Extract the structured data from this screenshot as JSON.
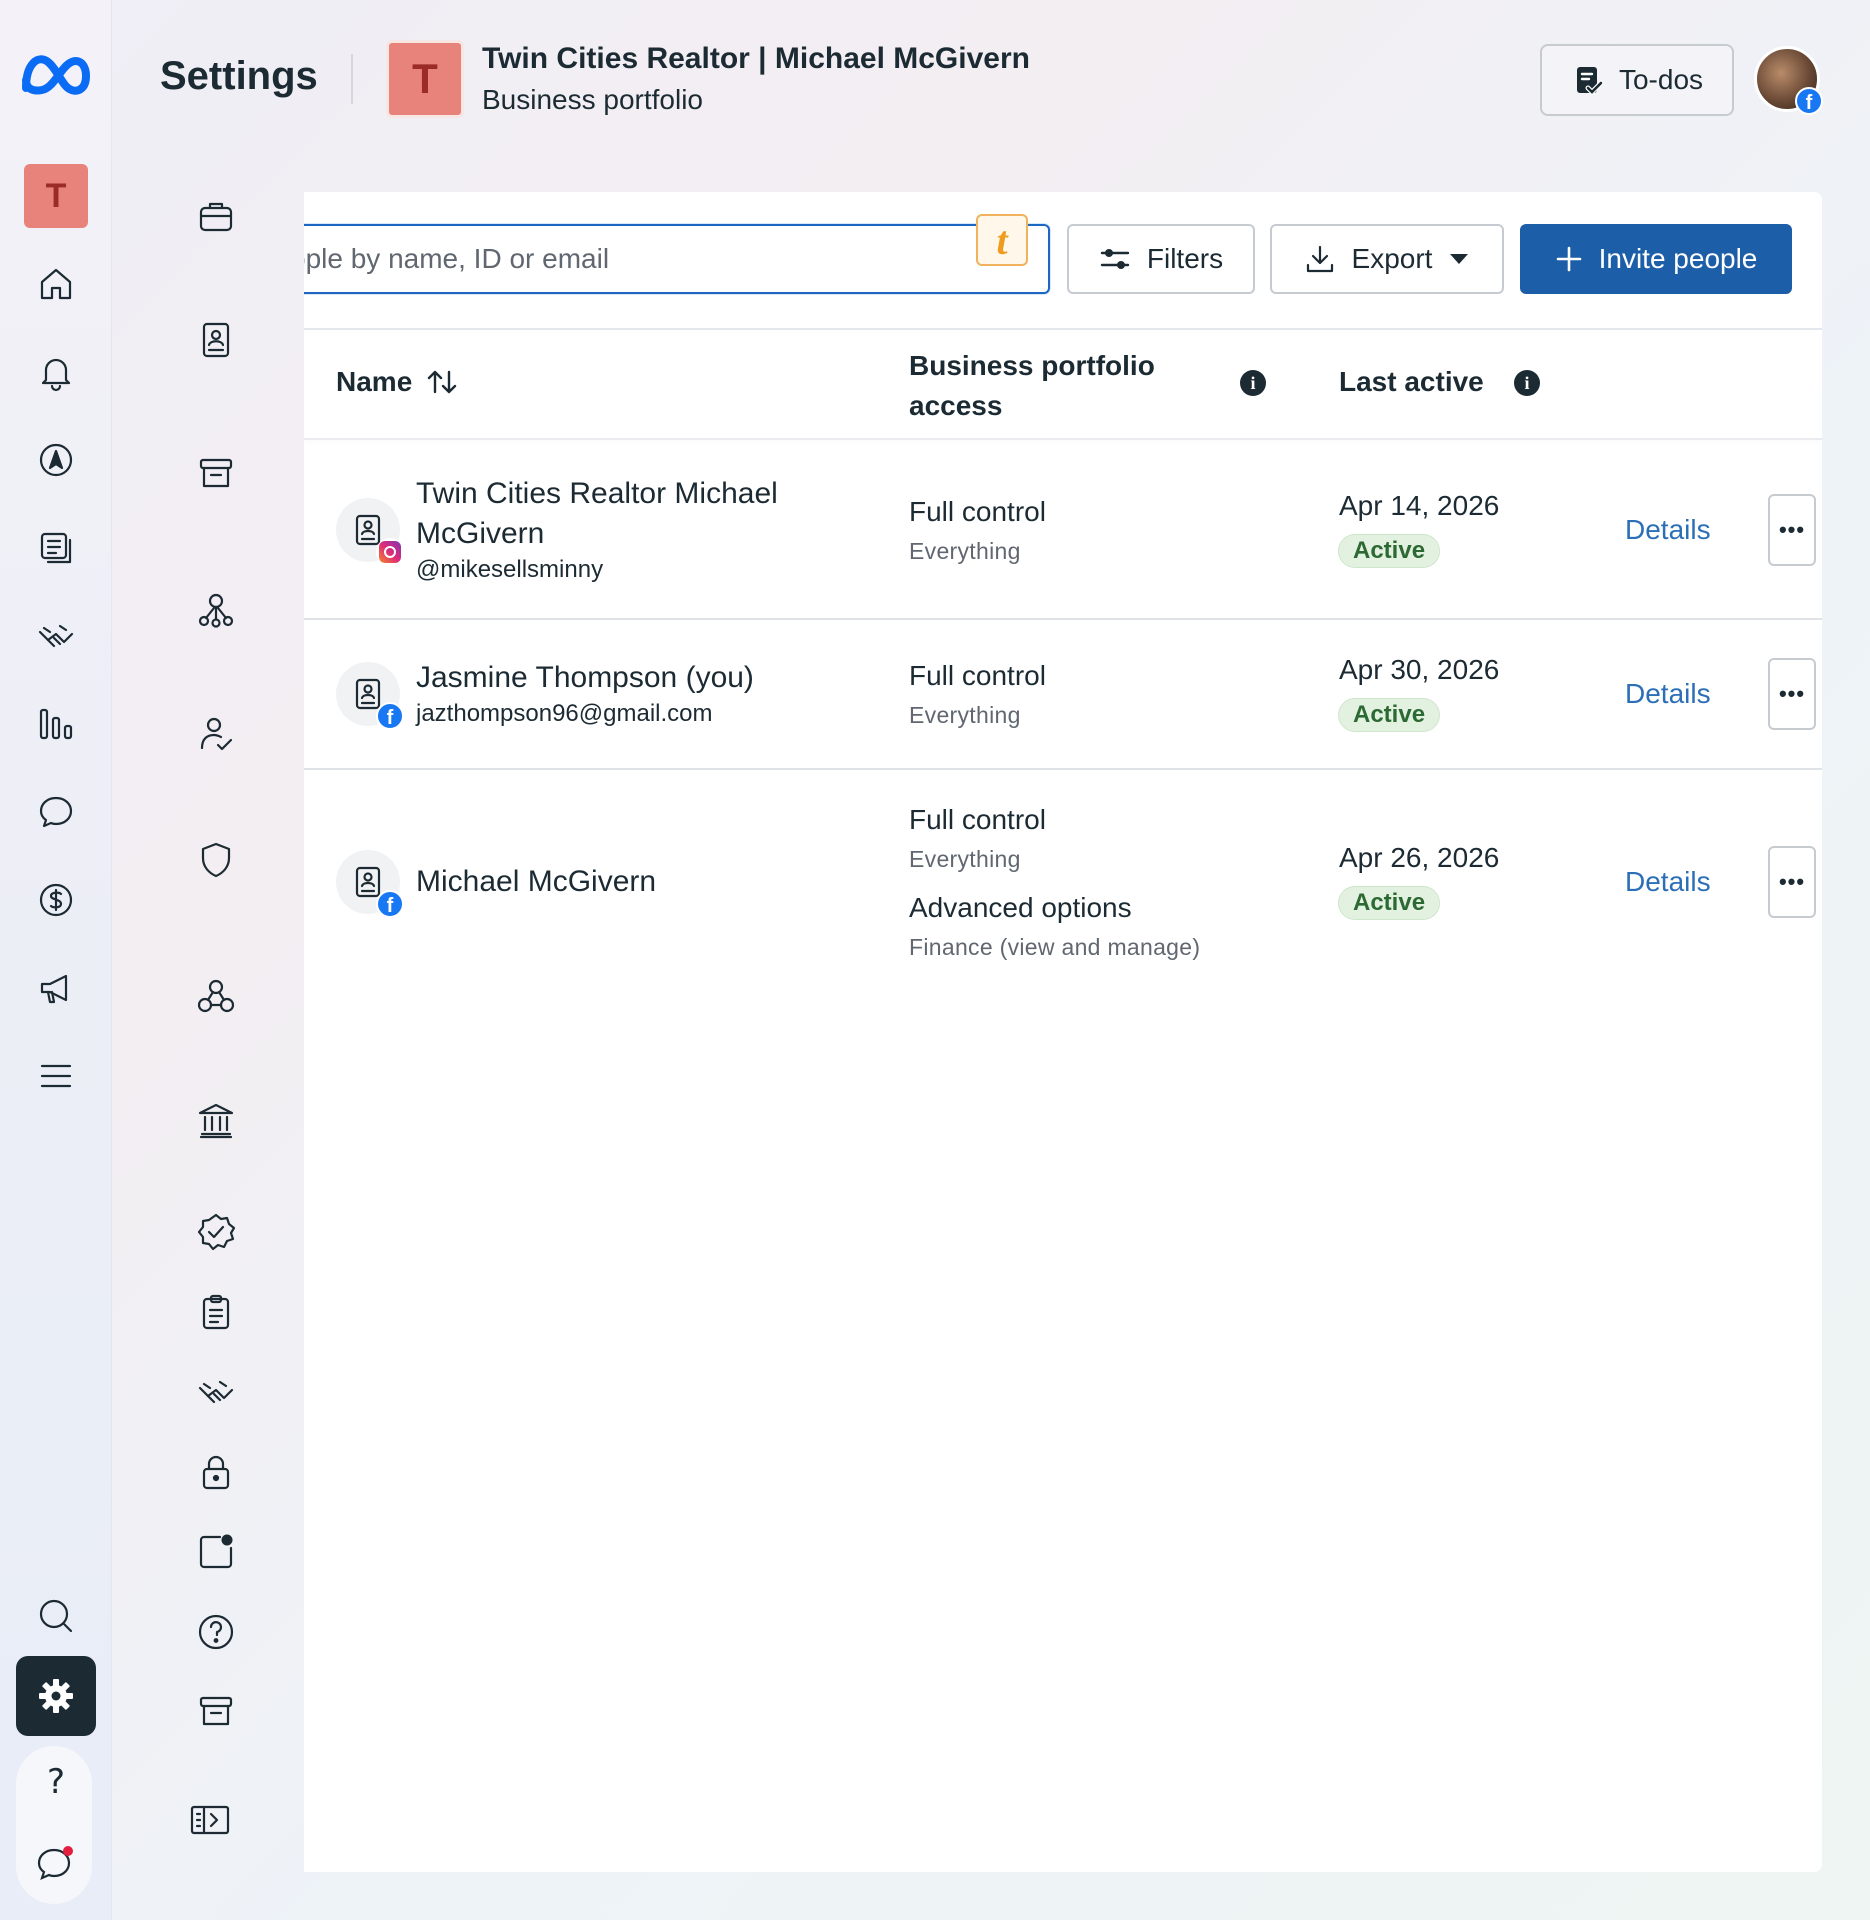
{
  "header": {
    "page_title": "Settings",
    "business_avatar_letter": "T",
    "business_name": "Twin Cities Realtor | Michael McGivern",
    "business_subtitle": "Business portfolio",
    "todos_label": "To-dos"
  },
  "rail": {
    "avatar_letter": "T",
    "help_glyph": "?",
    "icons": [
      "meta-logo-icon",
      "home-icon",
      "bell-icon",
      "compass-icon",
      "pages-icon",
      "handshake-icon",
      "insights-icon",
      "chat-icon",
      "dollar-icon",
      "megaphone-icon",
      "menu-icon",
      "search-icon",
      "gear-icon",
      "help-icon",
      "feedback-icon"
    ]
  },
  "settings_nav": {
    "icons": [
      "briefcase-icon",
      "user-card-icon",
      "archive-icon",
      "accounts-icon",
      "user-check-icon",
      "shield-icon",
      "integrations-icon",
      "bank-icon",
      "verified-icon",
      "clipboard-icon",
      "handshake-icon",
      "lock-icon",
      "notification-icon",
      "help-circle-icon",
      "archive-icon",
      "collapse-panel-icon"
    ]
  },
  "toolbar": {
    "search_placeholder": "ople by name, ID or email",
    "extension_badge": "t",
    "filters_label": "Filters",
    "export_label": "Export",
    "invite_label": "Invite people"
  },
  "table": {
    "col_name": "Name",
    "col_access_line1": "Business portfolio",
    "col_access_line2": "access",
    "col_last_active": "Last active",
    "info_glyph": "i",
    "rows": [
      {
        "name_line1": "Twin Cities Realtor Michael",
        "name_line2": "McGivern",
        "sub": "@mikesellsminny",
        "platform": "instagram",
        "access": "Full control",
        "access_sub": "Everything",
        "date": "Apr 14, 2026",
        "status": "Active",
        "details": "Details",
        "more": "•••"
      },
      {
        "name_line1": "Jasmine Thompson (you)",
        "sub": "jazthompson96@gmail.com",
        "platform": "facebook",
        "access": "Full control",
        "access_sub": "Everything",
        "date": "Apr 30, 2026",
        "status": "Active",
        "details": "Details",
        "more": "•••"
      },
      {
        "name_line1": "Michael McGivern",
        "platform": "facebook",
        "access": "Full control",
        "access_sub": "Everything",
        "access2": "Advanced options",
        "access2_sub": "Finance (view and manage)",
        "date": "Apr 26, 2026",
        "status": "Active",
        "details": "Details",
        "more": "•••"
      }
    ]
  },
  "colors": {
    "primary": "#1d5ea8",
    "link": "#2c6fb7",
    "avatar_bg": "#e8837b",
    "active_badge_bg": "#e3f1e1",
    "text": "#1c2b33"
  }
}
